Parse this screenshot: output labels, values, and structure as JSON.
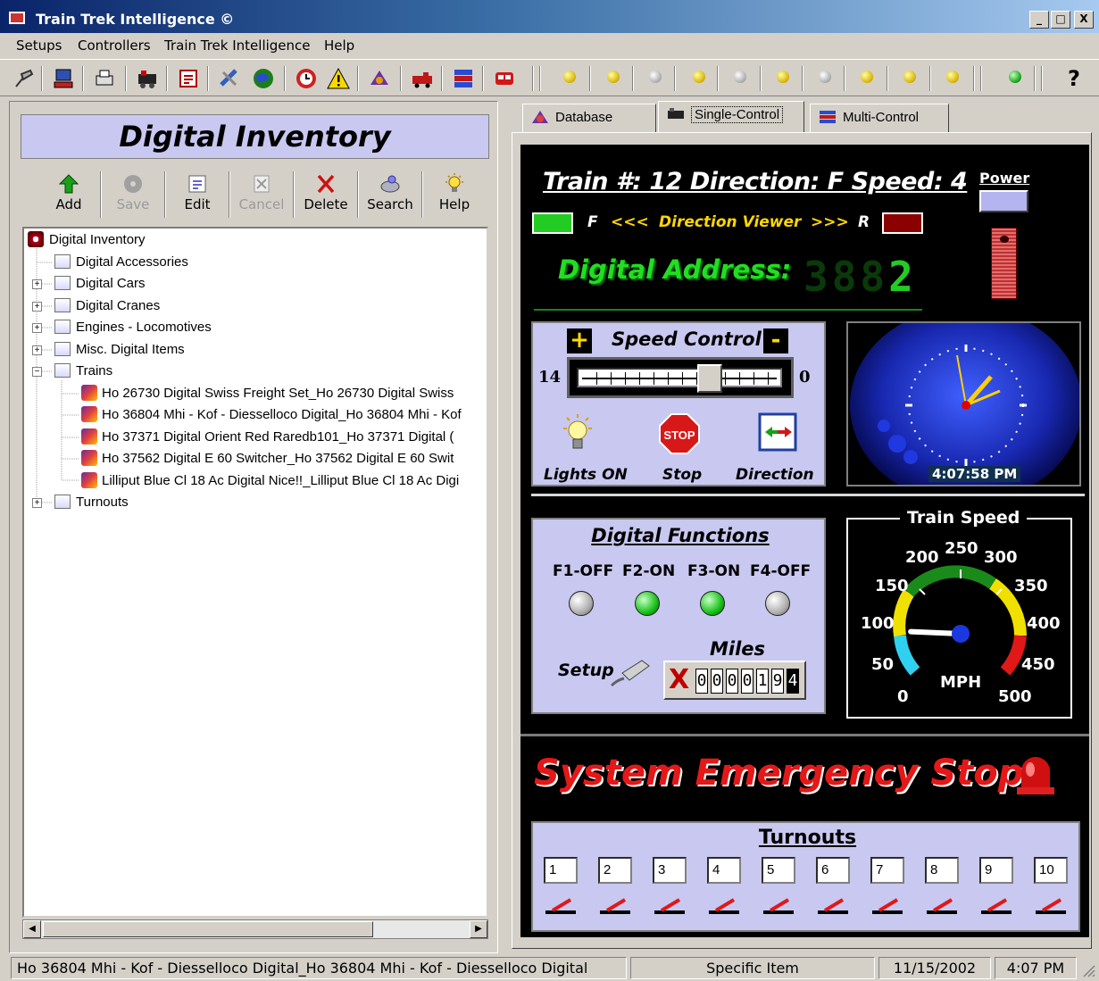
{
  "window": {
    "title": "Train Trek Intelligence ©",
    "minimize": "_",
    "maximize": "□",
    "close": "X"
  },
  "menu": [
    "Setups",
    "Controllers",
    "Train Trek Intelligence",
    "Help"
  ],
  "toolbar": {
    "help_glyph": "?"
  },
  "left_panel": {
    "title": "Digital Inventory",
    "buttons": [
      {
        "label": "Add",
        "enabled": true,
        "icon": "up-arrow-icon"
      },
      {
        "label": "Save",
        "enabled": false,
        "icon": "disk-icon"
      },
      {
        "label": "Edit",
        "enabled": true,
        "icon": "edit-doc-icon"
      },
      {
        "label": "Cancel",
        "enabled": false,
        "icon": "cancel-icon"
      },
      {
        "label": "Delete",
        "enabled": true,
        "icon": "delete-x-icon"
      },
      {
        "label": "Search",
        "enabled": true,
        "icon": "search-icon"
      },
      {
        "label": "Help",
        "enabled": true,
        "icon": "help-bulb-icon"
      }
    ],
    "tree": {
      "root": "Digital Inventory",
      "nodes": [
        "Digital Accessories",
        "Digital Cars",
        "Digital Cranes",
        "Engines - Locomotives",
        "Misc. Digital Items",
        "Trains",
        "Turnouts"
      ],
      "trains": [
        "Ho 26730 Digital Swiss Freight Set_Ho 26730 Digital Swiss",
        "Ho 36804 Mhi - Kof - Diesselloco Digital_Ho 36804 Mhi - Kof",
        "Ho 37371 Digital Orient Red Raredb101_Ho 37371 Digital (",
        "Ho 37562 Digital E 60 Switcher_Ho 37562 Digital E 60 Swit",
        "Lilliput Blue Cl 18 Ac Digital Nice!!_Lilliput Blue Cl 18 Ac Digi"
      ]
    }
  },
  "tabs": [
    {
      "label": "Database",
      "active": false
    },
    {
      "label": "Single-Control",
      "active": true
    },
    {
      "label": "Multi-Control",
      "active": false
    }
  ],
  "control": {
    "header": "Train #: 12 Direction: F Speed: 4",
    "power_label": "Power",
    "direction": {
      "f": "F",
      "left_arrows": "<<<",
      "label": "Direction Viewer",
      "right_arrows": ">>>",
      "r": "R"
    },
    "address_label": "Digital Address:",
    "address_display": {
      "dim": "388",
      "lit": "2"
    },
    "speed": {
      "title": "Speed Control",
      "plus": "+",
      "minus": "-",
      "max": "14",
      "min": "0",
      "position": 0.68
    },
    "lights_label": "Lights ON",
    "stop_label": "Stop",
    "stop_sign": "STOP",
    "direction_label": "Direction",
    "clock_time": "4:07:58 PM",
    "functions": {
      "title": "Digital Functions",
      "items": [
        {
          "label": "F1-OFF",
          "state": "off"
        },
        {
          "label": "F2-ON",
          "state": "on"
        },
        {
          "label": "F3-ON",
          "state": "on"
        },
        {
          "label": "F4-OFF",
          "state": "off"
        }
      ],
      "miles_label": "Miles",
      "setup_label": "Setup",
      "odometer": "0000194",
      "odometer_x": "X"
    },
    "gauge": {
      "title": "Train Speed",
      "unit": "MPH",
      "ticks": [
        "0",
        "50",
        "100",
        "150",
        "200",
        "250",
        "300",
        "350",
        "400",
        "450",
        "500"
      ],
      "value": 75
    },
    "emergency": "System Emergency Stop",
    "turnouts": {
      "title": "Turnouts",
      "items": [
        "1",
        "2",
        "3",
        "4",
        "5",
        "6",
        "7",
        "8",
        "9",
        "10"
      ]
    },
    "colors": {
      "forward": "#22cc22",
      "reverse": "#8b0000",
      "panel": "#c8c8f0",
      "emergency": "#e41818"
    }
  },
  "status": {
    "item": "Ho 36804 Mhi - Kof - Diesselloco Digital_Ho 36804 Mhi - Kof - Diesselloco Digital",
    "mode": "Specific Item",
    "date": "11/15/2002",
    "time": "4:07 PM"
  }
}
